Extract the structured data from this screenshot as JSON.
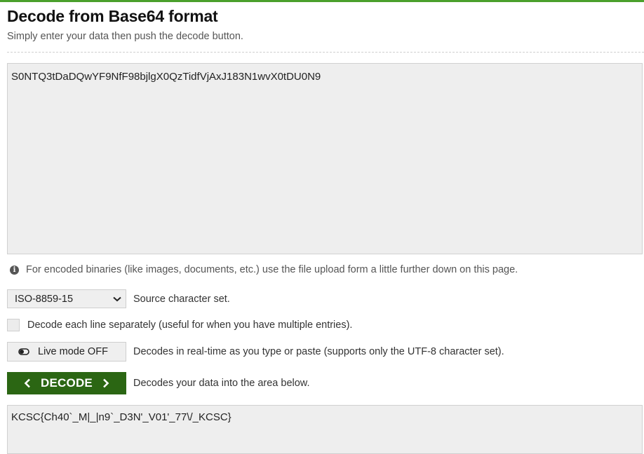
{
  "header": {
    "title": "Decode from Base64 format",
    "subtitle": "Simply enter your data then push the decode button."
  },
  "input": {
    "value": "S0NTQ3tDaDQwYF9NfF98bjlgX0QzTidfVjAxJ183N1wvX0tDU0N9"
  },
  "info": {
    "icon": "info-icon",
    "text": "For encoded binaries (like images, documents, etc.) use the file upload form a little further down on this page."
  },
  "charset": {
    "selected": "ISO-8859-15",
    "label": "Source character set."
  },
  "per_line": {
    "checked": false,
    "label": "Decode each line separately (useful for when you have multiple entries)."
  },
  "live_mode": {
    "button_label": "Live mode OFF",
    "description": "Decodes in real-time as you type or paste (supports only the UTF-8 character set)."
  },
  "decode": {
    "button_label": "DECODE",
    "description": "Decodes your data into the area below."
  },
  "output": {
    "value": "KCSC{Ch40`_M|_|n9`_D3N'_V01'_77\\/_KCSC}"
  },
  "colors": {
    "accent_green": "#4aa02c",
    "decode_button": "#2b6613",
    "field_bg": "#eeeeee"
  }
}
